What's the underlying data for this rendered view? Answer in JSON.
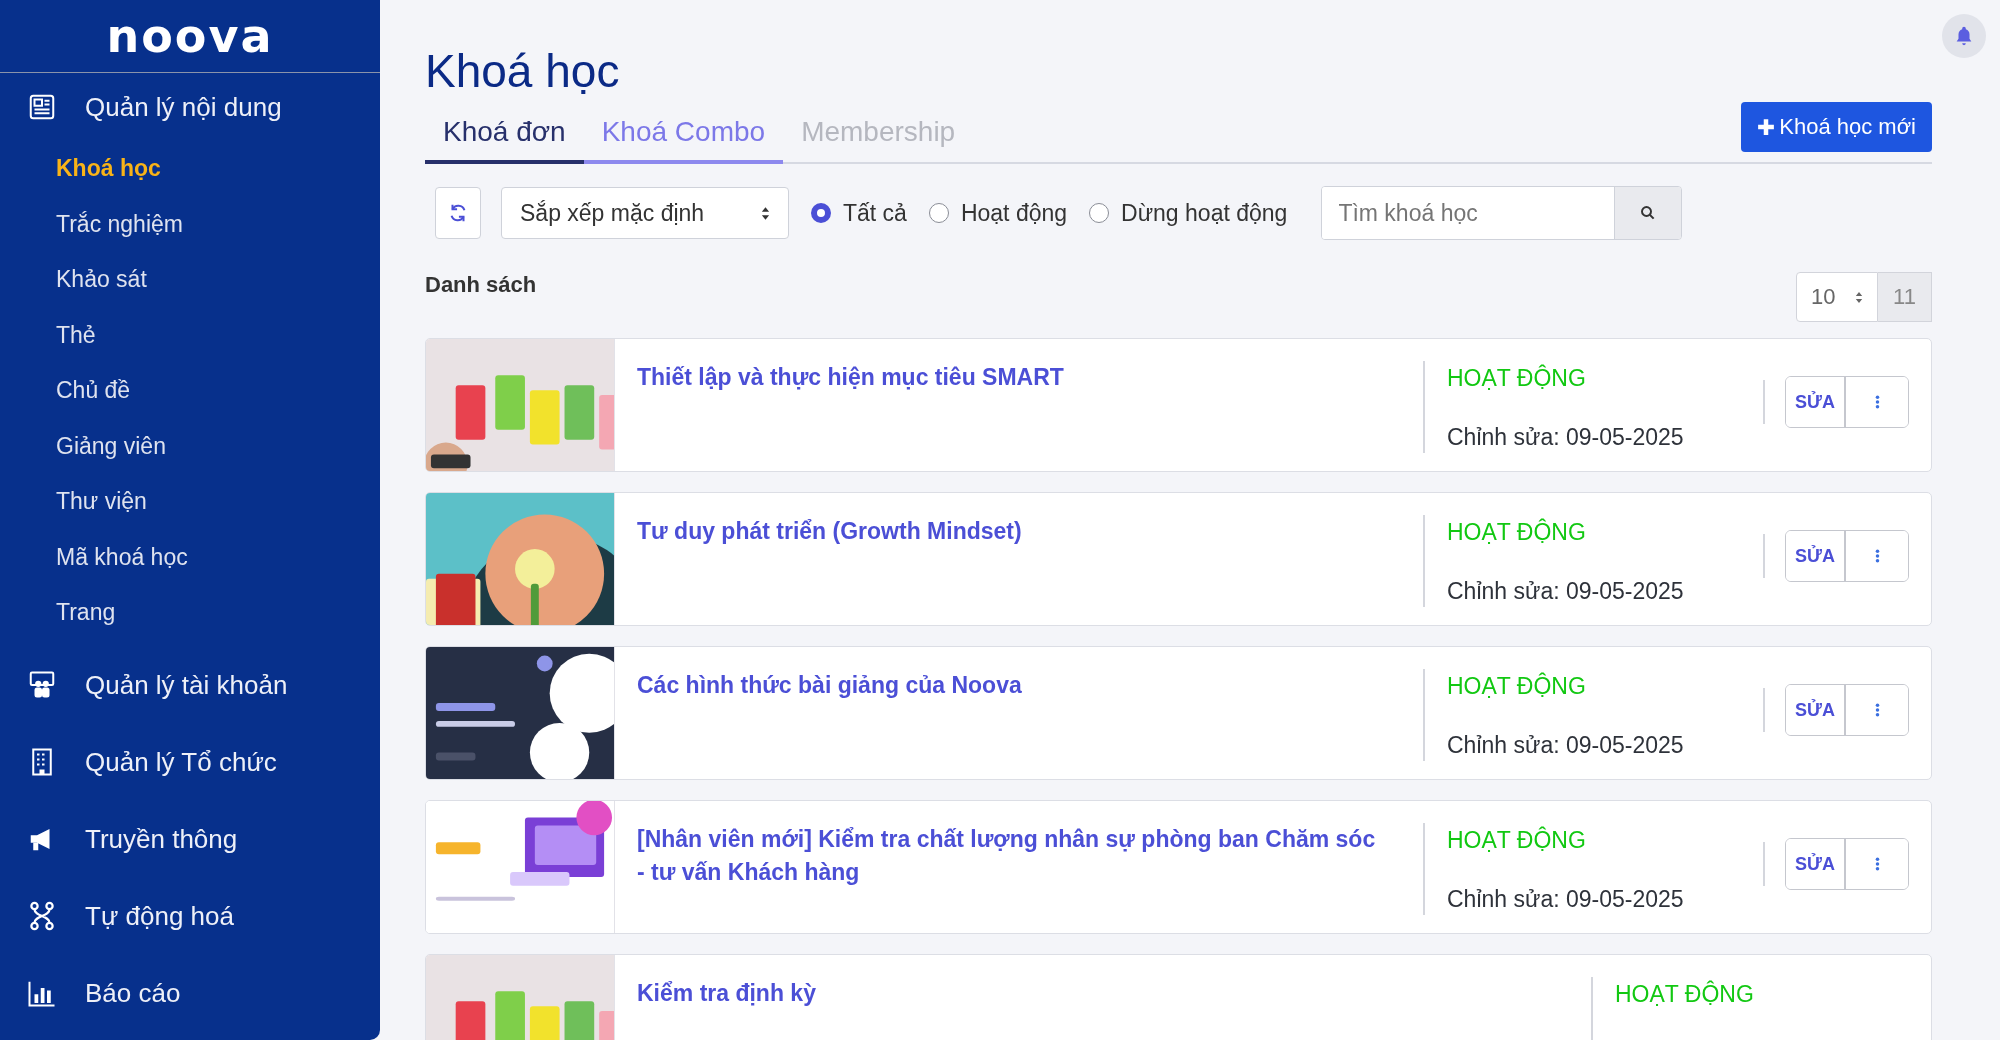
{
  "sidebar": {
    "logo": "noova",
    "items": [
      {
        "kind": "newspaper",
        "label": "Quản lý nội dung",
        "children": [
          {
            "label": "Khoá học",
            "selected": true
          },
          {
            "label": "Trắc nghiệm",
            "selected": false
          },
          {
            "label": "Khảo sát",
            "selected": false
          },
          {
            "label": "Thẻ",
            "selected": false
          },
          {
            "label": "Chủ đề",
            "selected": false
          },
          {
            "label": "Giảng viên",
            "selected": false
          },
          {
            "label": "Thư viện",
            "selected": false
          },
          {
            "label": "Mã khoá học",
            "selected": false
          },
          {
            "label": "Trang",
            "selected": false
          }
        ]
      },
      {
        "kind": "people",
        "label": "Quản lý tài khoản"
      },
      {
        "kind": "building",
        "label": "Quản lý Tổ chức"
      },
      {
        "kind": "megaphone",
        "label": "Truyền thông"
      },
      {
        "kind": "flow",
        "label": "Tự động hoá"
      },
      {
        "kind": "chart",
        "label": "Báo cáo"
      }
    ]
  },
  "header": {
    "title": "Khoá học",
    "new_button": "Khoá học mới"
  },
  "tabs": [
    {
      "label": "Khoá đơn",
      "selected": true,
      "hovered": false,
      "disabled": false
    },
    {
      "label": "Khoá Combo",
      "selected": false,
      "hovered": true,
      "disabled": false
    },
    {
      "label": "Membership",
      "selected": false,
      "hovered": false,
      "disabled": true
    }
  ],
  "toolbar": {
    "sort": "Sắp xếp mặc định",
    "filters": [
      {
        "label": "Tất cả",
        "selected": true
      },
      {
        "label": "Hoạt động",
        "selected": false
      },
      {
        "label": "Dừng hoạt động",
        "selected": false
      }
    ],
    "search": {
      "placeholder": "Tìm khoá học"
    }
  },
  "list": {
    "title": "Danh sách",
    "page_size": "10",
    "total": "11",
    "rows": [
      {
        "title": "Thiết lập và thực hiện mục tiêu SMART",
        "status": "HOẠT ĐỘNG",
        "edited": "Chỉnh sửa: 09-05-2025",
        "edit_label": "SỬA"
      },
      {
        "title": "Tư duy phát triển (Growth Mindset)",
        "status": "HOẠT ĐỘNG",
        "edited": "Chỉnh sửa: 09-05-2025",
        "edit_label": "SỬA"
      },
      {
        "title": "Các hình thức bài giảng của Noova",
        "status": "HOẠT ĐỘNG",
        "edited": "Chỉnh sửa: 09-05-2025",
        "edit_label": "SỬA"
      },
      {
        "title": "[Nhân viên mới] Kiểm tra chất lượng nhân sự phòng ban Chăm sóc - tư vấn Khách hàng",
        "status": "HOẠT ĐỘNG",
        "edited": "Chỉnh sửa: 09-05-2025",
        "edit_label": "SỬA"
      },
      {
        "title": "Kiểm tra định kỳ",
        "status": "HOẠT ĐỘNG"
      }
    ]
  }
}
